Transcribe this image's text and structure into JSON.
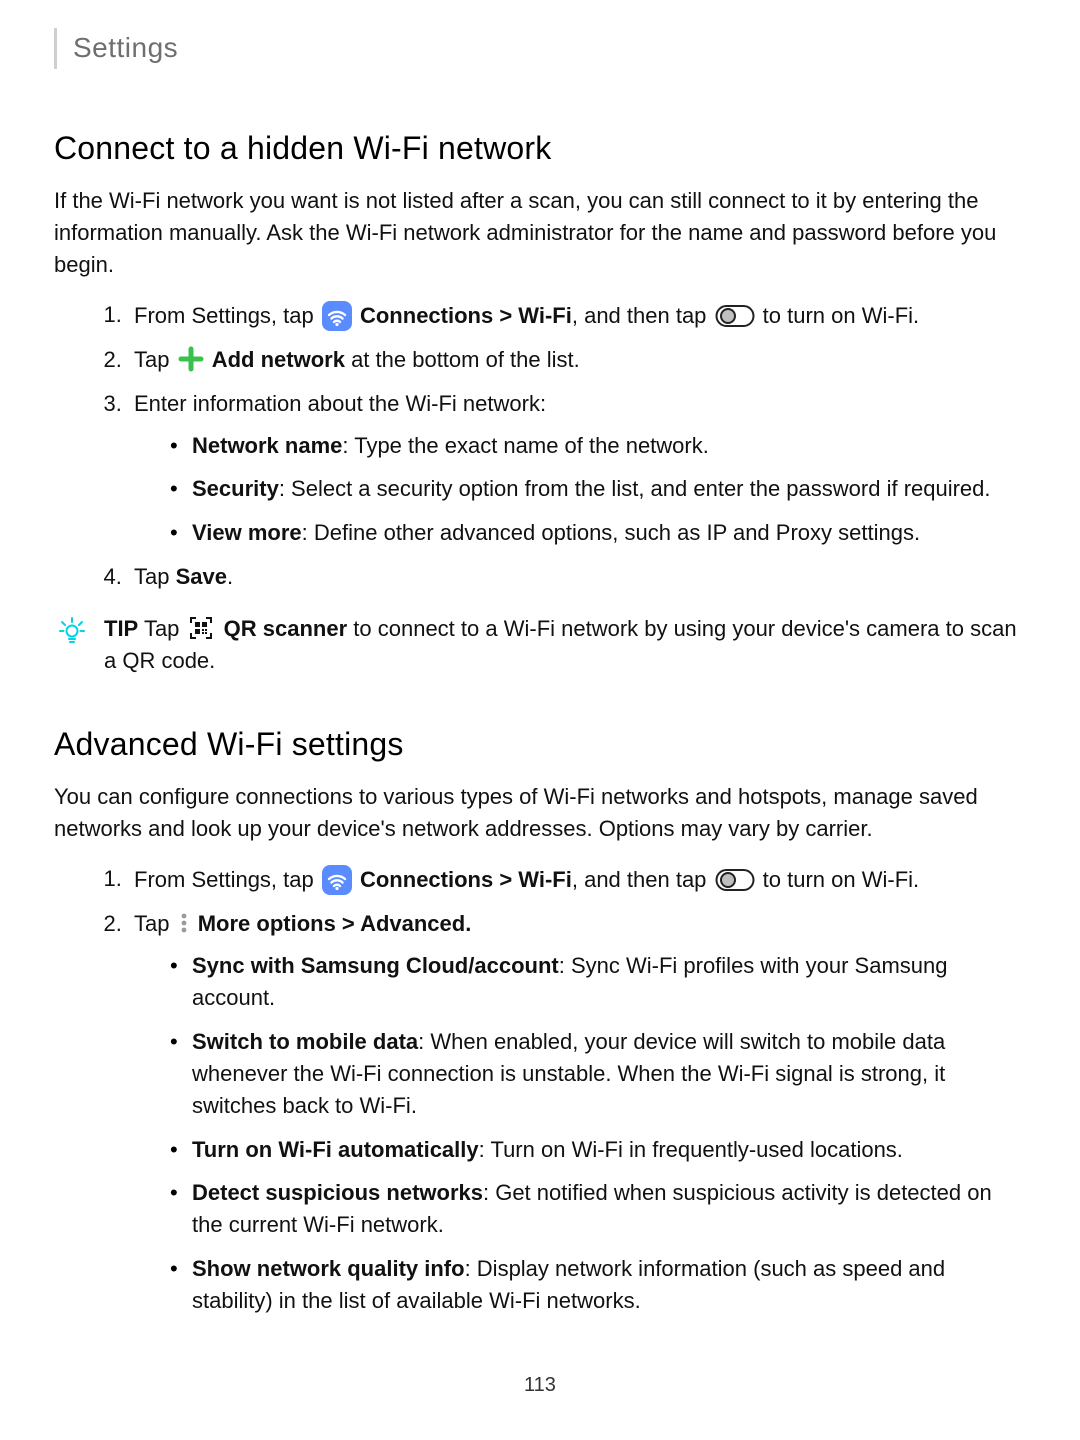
{
  "breadcrumb": "Settings",
  "section1": {
    "heading": "Connect to a hidden Wi-Fi network",
    "intro": "If the Wi-Fi network you want is not listed after a scan, you can still connect to it by entering the information manually. Ask the Wi-Fi network administrator for the name and password before you begin.",
    "step1": {
      "pre": "From Settings, tap ",
      "connections": "Connections",
      "gt_wifi": " > Wi-Fi",
      "mid": ", and then tap ",
      "post": " to turn on Wi-Fi."
    },
    "step2": {
      "pre": "Tap ",
      "addnet": "Add network",
      "post": " at the bottom of the list."
    },
    "step3": "Enter information about the Wi-Fi network:",
    "step3_b1_b": "Network name",
    "step3_b1_r": ": Type the exact name of the network.",
    "step3_b2_b": "Security",
    "step3_b2_r": ": Select a security option from the list, and enter the password if required.",
    "step3_b3_b": "View more",
    "step3_b3_r": ": Define other advanced options, such as IP and Proxy settings.",
    "step4_pre": "Tap ",
    "step4_b": "Save",
    "step4_post": ".",
    "tip_label": "TIP",
    "tip_tap": "  Tap ",
    "tip_qr_b": "QR scanner",
    "tip_rest": " to connect to a Wi-Fi network by using your device's camera to scan a QR code."
  },
  "section2": {
    "heading": "Advanced Wi-Fi settings",
    "intro": "You can configure connections to various types of Wi-Fi networks and hotspots, manage saved networks and look up your device's network addresses. Options may vary by carrier.",
    "step1": {
      "pre": "From Settings, tap ",
      "connections": "Connections",
      "gt_wifi": " > Wi-Fi",
      "mid": ", and then tap ",
      "post": " to turn on Wi-Fi."
    },
    "step2_pre": "Tap ",
    "step2_b": " More options > Advanced.",
    "b1_b": "Sync with Samsung Cloud/account",
    "b1_r": ": Sync Wi-Fi profiles with your Samsung account.",
    "b2_b": "Switch to mobile data",
    "b2_r": ": When enabled, your device will switch to mobile data whenever the Wi-Fi connection is unstable. When the Wi-Fi signal is strong, it switches back to Wi-Fi.",
    "b3_b": "Turn on Wi-Fi automatically",
    "b3_r": ": Turn on Wi-Fi in frequently-used locations.",
    "b4_b": "Detect suspicious networks",
    "b4_r": ": Get notified when suspicious activity is detected on the current Wi-Fi network.",
    "b5_b": "Show network quality info",
    "b5_r": ": Display network information (such as speed and stability) in the list of available Wi-Fi networks."
  },
  "page_number": "113"
}
